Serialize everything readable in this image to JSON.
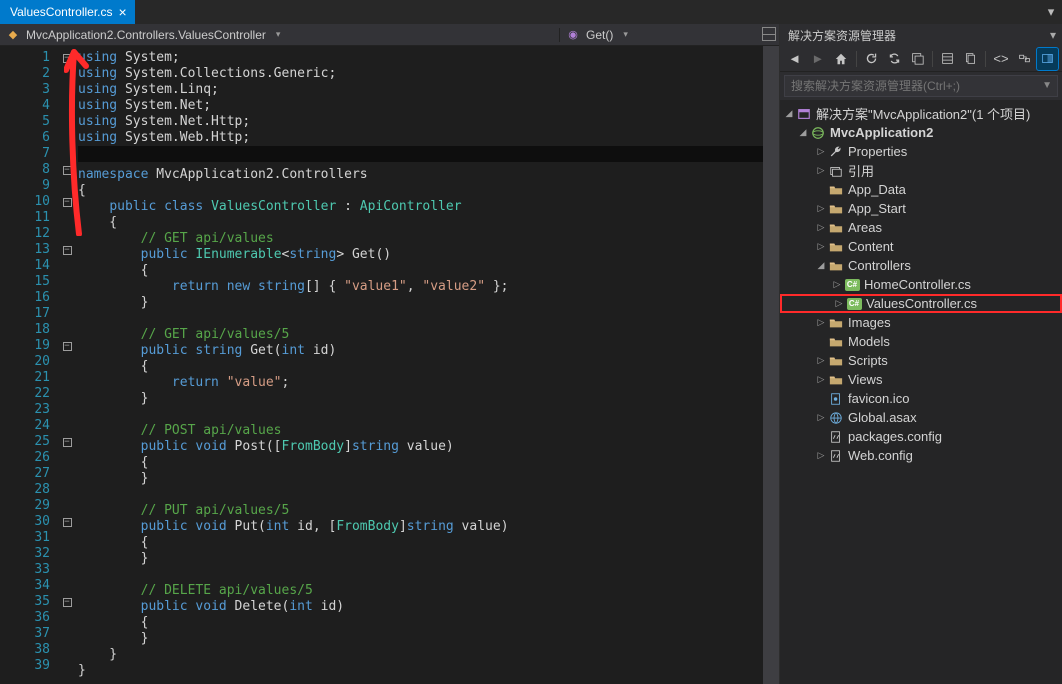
{
  "tab": {
    "title": "ValuesController.cs",
    "close_glyph": "×"
  },
  "navbar": {
    "class_label": "MvcApplication2.Controllers.ValuesController",
    "member_label": "Get()"
  },
  "code": {
    "lines": [
      [
        [
          "kw",
          "using"
        ],
        [
          "pln",
          " System;"
        ]
      ],
      [
        [
          "kw",
          "using"
        ],
        [
          "pln",
          " System.Collections.Generic;"
        ]
      ],
      [
        [
          "kw",
          "using"
        ],
        [
          "pln",
          " System.Linq;"
        ]
      ],
      [
        [
          "kw",
          "using"
        ],
        [
          "pln",
          " System.Net;"
        ]
      ],
      [
        [
          "kw",
          "using"
        ],
        [
          "pln",
          " System.Net.Http;"
        ]
      ],
      [
        [
          "kw",
          "using"
        ],
        [
          "pln",
          " System.Web.Http;"
        ]
      ],
      [
        [
          "pln",
          ""
        ]
      ],
      [
        [
          "kw",
          "namespace"
        ],
        [
          "pln",
          " MvcApplication2.Controllers"
        ]
      ],
      [
        [
          "pln",
          "{"
        ]
      ],
      [
        [
          "pln",
          "    "
        ],
        [
          "kw",
          "public class"
        ],
        [
          "pln",
          " "
        ],
        [
          "tp",
          "ValuesController"
        ],
        [
          "pln",
          " : "
        ],
        [
          "tp",
          "ApiController"
        ]
      ],
      [
        [
          "pln",
          "    {"
        ]
      ],
      [
        [
          "pln",
          "        "
        ],
        [
          "cmt",
          "// GET api/values"
        ]
      ],
      [
        [
          "pln",
          "        "
        ],
        [
          "kw",
          "public"
        ],
        [
          "pln",
          " "
        ],
        [
          "tp",
          "IEnumerable"
        ],
        [
          "pln",
          "<"
        ],
        [
          "kw",
          "string"
        ],
        [
          "pln",
          "> Get()"
        ]
      ],
      [
        [
          "pln",
          "        {"
        ]
      ],
      [
        [
          "pln",
          "            "
        ],
        [
          "kw",
          "return new string"
        ],
        [
          "pln",
          "[] { "
        ],
        [
          "str",
          "\"value1\""
        ],
        [
          "pln",
          ", "
        ],
        [
          "str",
          "\"value2\""
        ],
        [
          "pln",
          " };"
        ]
      ],
      [
        [
          "pln",
          "        }"
        ]
      ],
      [
        [
          "pln",
          ""
        ]
      ],
      [
        [
          "pln",
          "        "
        ],
        [
          "cmt",
          "// GET api/values/5"
        ]
      ],
      [
        [
          "pln",
          "        "
        ],
        [
          "kw",
          "public string"
        ],
        [
          "pln",
          " Get("
        ],
        [
          "kw",
          "int"
        ],
        [
          "pln",
          " id)"
        ]
      ],
      [
        [
          "pln",
          "        {"
        ]
      ],
      [
        [
          "pln",
          "            "
        ],
        [
          "kw",
          "return"
        ],
        [
          "pln",
          " "
        ],
        [
          "str",
          "\"value\""
        ],
        [
          "pln",
          ";"
        ]
      ],
      [
        [
          "pln",
          "        }"
        ]
      ],
      [
        [
          "pln",
          ""
        ]
      ],
      [
        [
          "pln",
          "        "
        ],
        [
          "cmt",
          "// POST api/values"
        ]
      ],
      [
        [
          "pln",
          "        "
        ],
        [
          "kw",
          "public void"
        ],
        [
          "pln",
          " Post(["
        ],
        [
          "tp",
          "FromBody"
        ],
        [
          "pln",
          "]"
        ],
        [
          "kw",
          "string"
        ],
        [
          "pln",
          " value)"
        ]
      ],
      [
        [
          "pln",
          "        {"
        ]
      ],
      [
        [
          "pln",
          "        }"
        ]
      ],
      [
        [
          "pln",
          ""
        ]
      ],
      [
        [
          "pln",
          "        "
        ],
        [
          "cmt",
          "// PUT api/values/5"
        ]
      ],
      [
        [
          "pln",
          "        "
        ],
        [
          "kw",
          "public void"
        ],
        [
          "pln",
          " Put("
        ],
        [
          "kw",
          "int"
        ],
        [
          "pln",
          " id, ["
        ],
        [
          "tp",
          "FromBody"
        ],
        [
          "pln",
          "]"
        ],
        [
          "kw",
          "string"
        ],
        [
          "pln",
          " value)"
        ]
      ],
      [
        [
          "pln",
          "        {"
        ]
      ],
      [
        [
          "pln",
          "        }"
        ]
      ],
      [
        [
          "pln",
          ""
        ]
      ],
      [
        [
          "pln",
          "        "
        ],
        [
          "cmt",
          "// DELETE api/values/5"
        ]
      ],
      [
        [
          "pln",
          "        "
        ],
        [
          "kw",
          "public void"
        ],
        [
          "pln",
          " Delete("
        ],
        [
          "kw",
          "int"
        ],
        [
          "pln",
          " id)"
        ]
      ],
      [
        [
          "pln",
          "        {"
        ]
      ],
      [
        [
          "pln",
          "        }"
        ]
      ],
      [
        [
          "pln",
          "    }"
        ]
      ],
      [
        [
          "pln",
          "}"
        ]
      ]
    ],
    "fold_rows": {
      "1": "box",
      "8": "box",
      "10": "box",
      "13": "box",
      "19": "box",
      "25": "box",
      "30": "box",
      "35": "box"
    }
  },
  "solution_explorer": {
    "title": "解决方案资源管理器",
    "search_placeholder": "搜索解决方案资源管理器(Ctrl+;)",
    "solution_label": "解决方案\"MvcApplication2\"(1 个项目)",
    "project_label": "MvcApplication2",
    "nodes": [
      {
        "indent": 2,
        "exp": "▷",
        "icon": "wrench",
        "label": "Properties"
      },
      {
        "indent": 2,
        "exp": "▷",
        "icon": "ref",
        "label": "引用"
      },
      {
        "indent": 2,
        "exp": "",
        "icon": "folder",
        "label": "App_Data"
      },
      {
        "indent": 2,
        "exp": "▷",
        "icon": "folder",
        "label": "App_Start"
      },
      {
        "indent": 2,
        "exp": "▷",
        "icon": "folder",
        "label": "Areas"
      },
      {
        "indent": 2,
        "exp": "▷",
        "icon": "folder",
        "label": "Content"
      },
      {
        "indent": 2,
        "exp": "◢",
        "icon": "folder",
        "label": "Controllers"
      },
      {
        "indent": 3,
        "exp": "▷",
        "icon": "cs",
        "label": "HomeController.cs"
      },
      {
        "indent": 3,
        "exp": "▷",
        "icon": "cs",
        "label": "ValuesController.cs",
        "highlight": true
      },
      {
        "indent": 2,
        "exp": "▷",
        "icon": "folder",
        "label": "Images"
      },
      {
        "indent": 2,
        "exp": "",
        "icon": "folder",
        "label": "Models"
      },
      {
        "indent": 2,
        "exp": "▷",
        "icon": "folder",
        "label": "Scripts"
      },
      {
        "indent": 2,
        "exp": "▷",
        "icon": "folder",
        "label": "Views"
      },
      {
        "indent": 2,
        "exp": "",
        "icon": "fav",
        "label": "favicon.ico"
      },
      {
        "indent": 2,
        "exp": "▷",
        "icon": "globe",
        "label": "Global.asax"
      },
      {
        "indent": 2,
        "exp": "",
        "icon": "xml",
        "label": "packages.config"
      },
      {
        "indent": 2,
        "exp": "▷",
        "icon": "xml",
        "label": "Web.config"
      }
    ]
  },
  "toolbar_icons": [
    "back",
    "forward",
    "home",
    "sep",
    "refresh",
    "sync",
    "collapse",
    "sep2",
    "props",
    "showall",
    "sep3",
    "code",
    "class",
    "preview"
  ]
}
